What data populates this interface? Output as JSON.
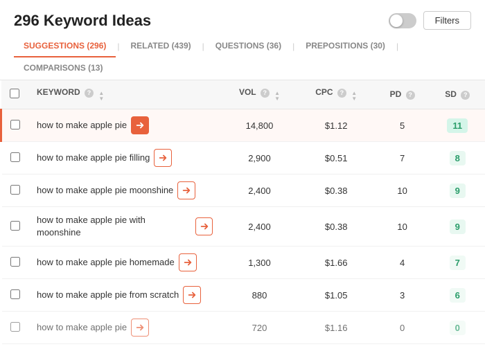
{
  "header": {
    "title": "296 Keyword Ideas",
    "filter_label": "Filters"
  },
  "tabs": [
    {
      "label": "SUGGESTIONS (296)",
      "active": true
    },
    {
      "label": "RELATED (439)",
      "active": false
    },
    {
      "label": "QUESTIONS (36)",
      "active": false
    },
    {
      "label": "PREPOSITIONS (30)",
      "active": false
    },
    {
      "label": "COMPARISONS (13)",
      "active": false
    }
  ],
  "table": {
    "columns": [
      {
        "key": "keyword",
        "label": "KEYWORD"
      },
      {
        "key": "vol",
        "label": "VOL"
      },
      {
        "key": "cpc",
        "label": "CPC"
      },
      {
        "key": "pd",
        "label": "PD"
      },
      {
        "key": "sd",
        "label": "SD"
      }
    ],
    "rows": [
      {
        "keyword": "how to make apple pie",
        "vol": "14,800",
        "cpc": "$1.12",
        "pd": "5",
        "sd": "11",
        "highlight": true,
        "sd_class": "sd-green"
      },
      {
        "keyword": "how to make apple pie filling",
        "vol": "2,900",
        "cpc": "$0.51",
        "pd": "7",
        "sd": "8",
        "highlight": false,
        "sd_class": "sd-light"
      },
      {
        "keyword": "how to make apple pie moonshine",
        "vol": "2,400",
        "cpc": "$0.38",
        "pd": "10",
        "sd": "9",
        "highlight": false,
        "sd_class": "sd-light"
      },
      {
        "keyword": "how to make apple pie with moonshine",
        "vol": "2,400",
        "cpc": "$0.38",
        "pd": "10",
        "sd": "9",
        "highlight": false,
        "sd_class": "sd-light"
      },
      {
        "keyword": "how to make apple pie homemade",
        "vol": "1,300",
        "cpc": "$1.66",
        "pd": "4",
        "sd": "7",
        "highlight": false,
        "sd_class": "sd-lighter"
      },
      {
        "keyword": "how to make apple pie from scratch",
        "vol": "880",
        "cpc": "$1.05",
        "pd": "3",
        "sd": "6",
        "highlight": false,
        "sd_class": "sd-lighter"
      },
      {
        "keyword": "how to make apple pie",
        "vol": "720",
        "cpc": "$1.16",
        "pd": "0",
        "sd": "0",
        "highlight": false,
        "sd_class": "sd-lighter",
        "partial": true
      }
    ]
  }
}
